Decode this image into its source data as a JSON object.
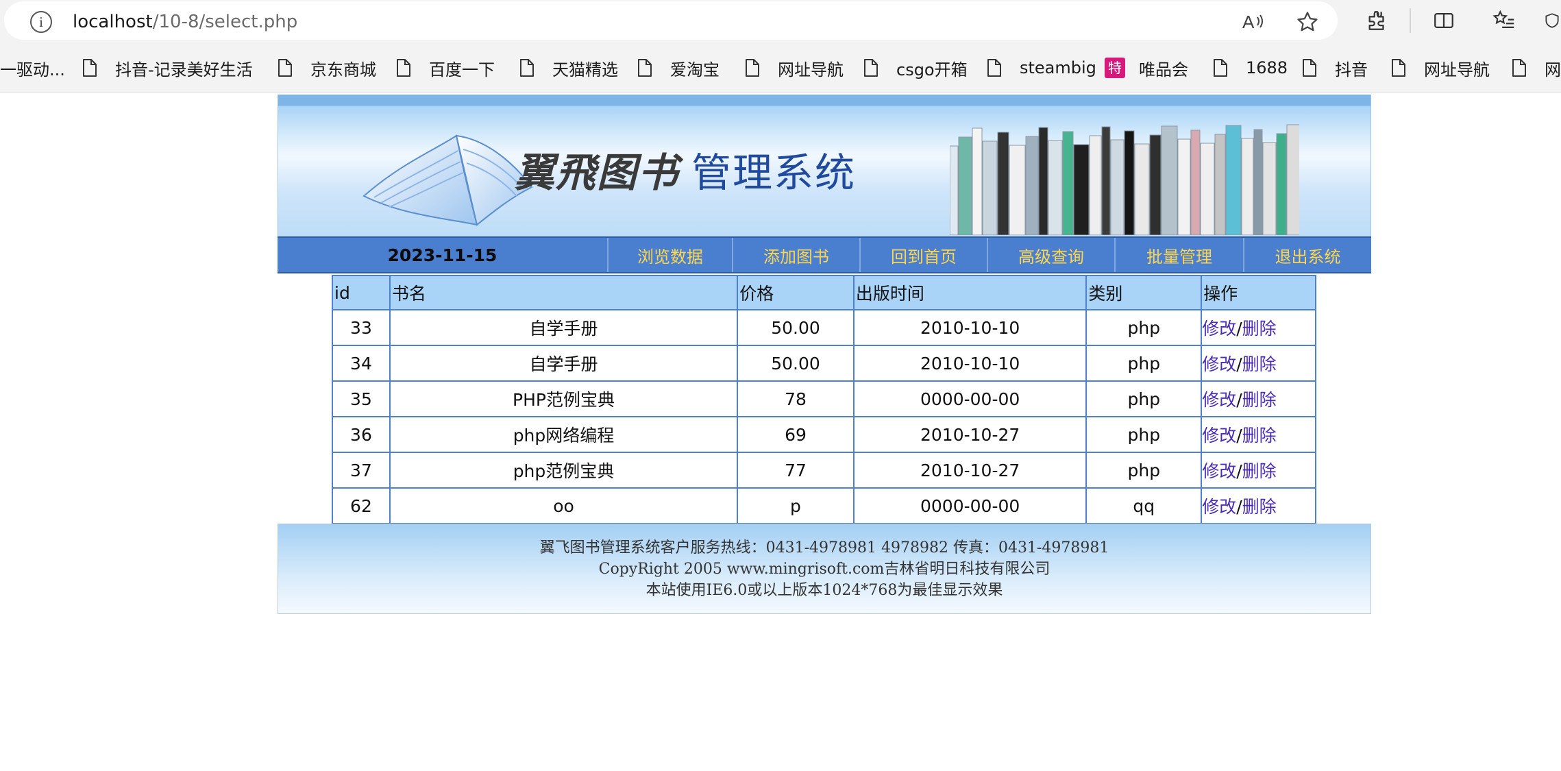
{
  "browser": {
    "url_host": "localhost",
    "url_path": "/10-8/select.php",
    "icons": [
      "info-icon",
      "read-aloud-icon",
      "favorite-star-icon",
      "extensions-icon",
      "split-screen-icon",
      "favorites-list-icon",
      "profile-icon"
    ],
    "bookmarks": [
      {
        "label": "一驱动...",
        "icon": "none"
      },
      {
        "label": "抖音-记录美好生活",
        "icon": "page-icon"
      },
      {
        "label": "京东商城",
        "icon": "page-icon"
      },
      {
        "label": "百度一下",
        "icon": "page-icon"
      },
      {
        "label": "天猫精选",
        "icon": "page-icon"
      },
      {
        "label": "爱淘宝",
        "icon": "page-icon"
      },
      {
        "label": "网址导航",
        "icon": "page-icon"
      },
      {
        "label": "csgo开箱",
        "icon": "page-icon"
      },
      {
        "label": "steambig",
        "icon": "page-icon"
      },
      {
        "label": "唯品会",
        "icon": "vip-icon",
        "icon_text": "特",
        "icon_color": "#d7197c"
      },
      {
        "label": "1688",
        "icon": "page-icon"
      },
      {
        "label": "抖音",
        "icon": "page-icon"
      },
      {
        "label": "网址导航",
        "icon": "page-icon"
      },
      {
        "label": "网址",
        "icon": "page-icon"
      }
    ]
  },
  "header": {
    "title_calligraphy": "翼飛图书",
    "title_main": "管理系统"
  },
  "nav": {
    "date": "2023-11-15",
    "items": [
      "浏览数据",
      "添加图书",
      "回到首页",
      "高级查询",
      "批量管理",
      "退出系统"
    ],
    "link_color": "#ffd54a"
  },
  "table": {
    "headers": [
      "id",
      "书名",
      "价格",
      "出版时间",
      "类别",
      "操作"
    ],
    "rows": [
      {
        "id": "33",
        "name": "自学手册",
        "price": "50.00",
        "date": "2010-10-10",
        "type": "php"
      },
      {
        "id": "34",
        "name": "自学手册",
        "price": "50.00",
        "date": "2010-10-10",
        "type": "php"
      },
      {
        "id": "35",
        "name": "PHP范例宝典",
        "price": "78",
        "date": "0000-00-00",
        "type": "php"
      },
      {
        "id": "36",
        "name": "php网络编程",
        "price": "69",
        "date": "2010-10-27",
        "type": "php"
      },
      {
        "id": "37",
        "name": "php范例宝典",
        "price": "77",
        "date": "2010-10-27",
        "type": "php"
      },
      {
        "id": "62",
        "name": "oo",
        "price": "p",
        "date": "0000-00-00",
        "type": "qq"
      }
    ],
    "edit_label": "修改",
    "separator": "/",
    "delete_label": "删除",
    "header_color": "#a9d4f7",
    "border_color": "#4d80cf"
  },
  "footer": {
    "line1": "翼飞图书管理系统客户服务热线：0431-4978981 4978982 传真：0431-4978981",
    "line2": "CopyRight 2005 www.mingrisoft.com吉林省明日科技有限公司",
    "line3": "本站使用IE6.0或以上版本1024*768为最佳显示效果"
  }
}
